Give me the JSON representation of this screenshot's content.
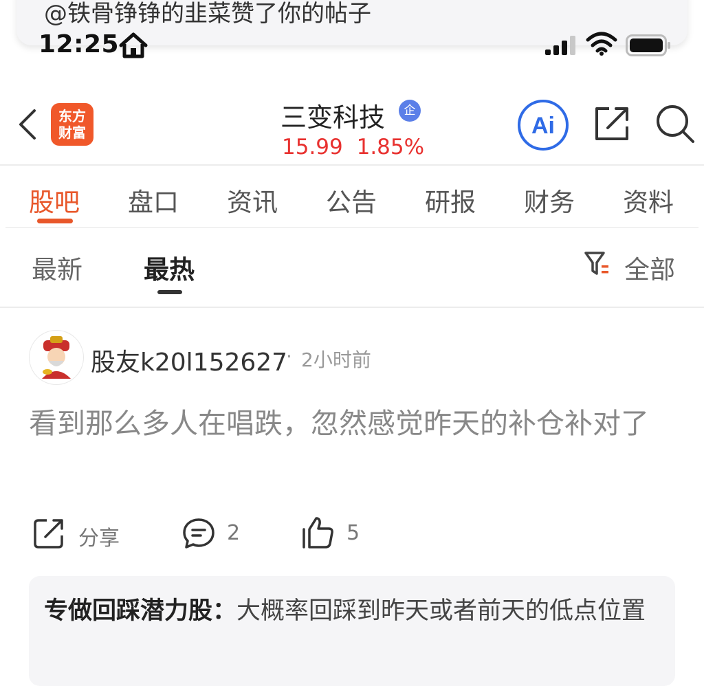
{
  "notification": {
    "text": "@铁骨铮铮的韭菜赞了你的帖子"
  },
  "status_bar": {
    "time": "12:25"
  },
  "header": {
    "logo_line1": "东方",
    "logo_line2": "财富",
    "stock_name": "三变科技",
    "verified_badge": "企",
    "price": "15.99",
    "change_pct": "1.85%",
    "ai_label": "Ai",
    "price_color": "#e8312f",
    "accent_color": "#e8572a"
  },
  "tabs": [
    {
      "label": "股吧",
      "active": true
    },
    {
      "label": "盘口"
    },
    {
      "label": "资讯"
    },
    {
      "label": "公告"
    },
    {
      "label": "研报"
    },
    {
      "label": "财务"
    },
    {
      "label": "资料"
    }
  ],
  "sort": {
    "options": [
      {
        "label": "最新"
      },
      {
        "label": "最热",
        "active": true
      }
    ],
    "filter_label": "全部"
  },
  "post": {
    "username": "股友k20l152627",
    "separator": "·",
    "time": "2小时前",
    "body": "看到那么多人在唱跌，忽然感觉昨天的补仓补对了",
    "actions": {
      "share_label": "分享",
      "comment_count": "2",
      "like_count": "5"
    },
    "quote": {
      "author": "专做回踩潜力股：",
      "text": "大概率回踩到昨天或者前天的低点位置"
    }
  },
  "icons": [
    "home-icon",
    "signal-icon",
    "wifi-icon",
    "battery-icon",
    "back-arrow-icon",
    "verified-icon",
    "ai-icon",
    "share-icon",
    "search-icon",
    "filter-icon",
    "avatar-icon",
    "comment-icon",
    "like-icon"
  ]
}
